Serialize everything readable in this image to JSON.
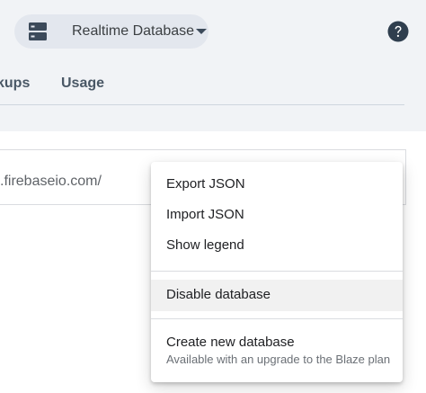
{
  "header": {
    "product_switcher": {
      "label": "Realtime Database",
      "icon": "database-icon"
    },
    "help_icon": "help-circle-icon"
  },
  "tabs": [
    {
      "label": "kups"
    },
    {
      "label": "Usage"
    }
  ],
  "database": {
    "url": ".firebaseio.com/"
  },
  "menu": {
    "items": [
      {
        "label": "Export JSON"
      },
      {
        "label": "Import JSON"
      },
      {
        "label": "Show legend"
      },
      {
        "label": "Disable database"
      },
      {
        "label": "Create new database",
        "sublabel": "Available with an upgrade to the Blaze plan"
      }
    ]
  },
  "colors": {
    "top_background": "#f1f3f6",
    "switcher_background": "#e3e7ee",
    "icon_color": "#3c4a5a",
    "help_color": "#2f3e4e",
    "hover_background": "#f1f1f1"
  }
}
